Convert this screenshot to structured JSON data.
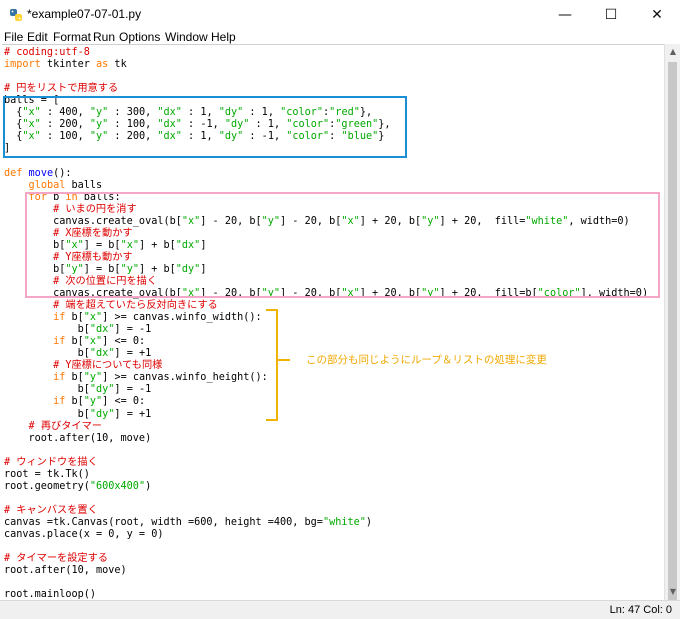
{
  "window": {
    "title": "*example07-07-01.py",
    "minimize_glyph": "—",
    "maximize_glyph": "☐",
    "close_glyph": "✕"
  },
  "menu": [
    "File",
    "Edit",
    "Format",
    "Run",
    "Options",
    "Window",
    "Help"
  ],
  "code": [
    [
      [
        "com",
        "# coding:utf-8"
      ]
    ],
    [
      [
        "kw",
        "import"
      ],
      [
        "",
        " tkinter "
      ],
      [
        "kw",
        "as"
      ],
      [
        "",
        " tk"
      ]
    ],
    [
      [
        "",
        ""
      ]
    ],
    [
      [
        "com",
        "# 円をリストで用意する"
      ]
    ],
    [
      [
        "",
        "balls = ["
      ]
    ],
    [
      [
        "",
        "  {"
      ],
      [
        "str",
        "\"x\""
      ],
      [
        "",
        " : 400, "
      ],
      [
        "str",
        "\"y\""
      ],
      [
        "",
        " : 300, "
      ],
      [
        "str",
        "\"dx\""
      ],
      [
        "",
        " : 1, "
      ],
      [
        "str",
        "\"dy\""
      ],
      [
        "",
        " : 1, "
      ],
      [
        "str",
        "\"color\""
      ],
      [
        "",
        ":"
      ],
      [
        "str",
        "\"red\""
      ],
      [
        "",
        "},"
      ]
    ],
    [
      [
        "",
        "  {"
      ],
      [
        "str",
        "\"x\""
      ],
      [
        "",
        " : 200, "
      ],
      [
        "str",
        "\"y\""
      ],
      [
        "",
        " : 100, "
      ],
      [
        "str",
        "\"dx\""
      ],
      [
        "",
        " : -1, "
      ],
      [
        "str",
        "\"dy\""
      ],
      [
        "",
        " : 1, "
      ],
      [
        "str",
        "\"color\""
      ],
      [
        "",
        ":"
      ],
      [
        "str",
        "\"green\""
      ],
      [
        "",
        "},"
      ]
    ],
    [
      [
        "",
        "  {"
      ],
      [
        "str",
        "\"x\""
      ],
      [
        "",
        " : 100, "
      ],
      [
        "str",
        "\"y\""
      ],
      [
        "",
        " : 200, "
      ],
      [
        "str",
        "\"dx\""
      ],
      [
        "",
        " : 1, "
      ],
      [
        "str",
        "\"dy\""
      ],
      [
        "",
        " : -1, "
      ],
      [
        "str",
        "\"color\""
      ],
      [
        "",
        ": "
      ],
      [
        "str",
        "\"blue\""
      ],
      [
        "",
        "}"
      ]
    ],
    [
      [
        "",
        "]"
      ]
    ],
    [
      [
        "",
        ""
      ]
    ],
    [
      [
        "kw",
        "def"
      ],
      [
        "",
        " "
      ],
      [
        "def",
        "move"
      ],
      [
        "",
        "():"
      ]
    ],
    [
      [
        "",
        "    "
      ],
      [
        "kw",
        "global"
      ],
      [
        "",
        " balls"
      ]
    ],
    [
      [
        "",
        "    "
      ],
      [
        "kw",
        "for"
      ],
      [
        "",
        " b "
      ],
      [
        "kw",
        "in"
      ],
      [
        "",
        " balls:"
      ]
    ],
    [
      [
        "",
        "        "
      ],
      [
        "com",
        "# いまの円を消す"
      ]
    ],
    [
      [
        "",
        "        canvas.create_oval(b["
      ],
      [
        "str",
        "\"x\""
      ],
      [
        "",
        "] - 20, b["
      ],
      [
        "str",
        "\"y\""
      ],
      [
        "",
        "] - 20, b["
      ],
      [
        "str",
        "\"x\""
      ],
      [
        "",
        "] + 20, b["
      ],
      [
        "str",
        "\"y\""
      ],
      [
        "",
        "] + 20,  fill="
      ],
      [
        "str",
        "\"white\""
      ],
      [
        "",
        ", width=0)"
      ]
    ],
    [
      [
        "",
        "        "
      ],
      [
        "com",
        "# X座標を動かす"
      ]
    ],
    [
      [
        "",
        "        b["
      ],
      [
        "str",
        "\"x\""
      ],
      [
        "",
        "] = b["
      ],
      [
        "str",
        "\"x\""
      ],
      [
        "",
        "] + b["
      ],
      [
        "str",
        "\"dx\""
      ],
      [
        "",
        "]"
      ]
    ],
    [
      [
        "",
        "        "
      ],
      [
        "com",
        "# Y座標も動かす"
      ]
    ],
    [
      [
        "",
        "        b["
      ],
      [
        "str",
        "\"y\""
      ],
      [
        "",
        "] = b["
      ],
      [
        "str",
        "\"y\""
      ],
      [
        "",
        "] + b["
      ],
      [
        "str",
        "\"dy\""
      ],
      [
        "",
        "]"
      ]
    ],
    [
      [
        "",
        "        "
      ],
      [
        "com",
        "# 次の位置に円を描く"
      ]
    ],
    [
      [
        "",
        "        canvas.create_oval(b["
      ],
      [
        "str",
        "\"x\""
      ],
      [
        "",
        "] - 20, b["
      ],
      [
        "str",
        "\"y\""
      ],
      [
        "",
        "] - 20, b["
      ],
      [
        "str",
        "\"x\""
      ],
      [
        "",
        "] + 20, b["
      ],
      [
        "str",
        "\"y\""
      ],
      [
        "",
        "] + 20,  fill=b["
      ],
      [
        "str",
        "\"color\""
      ],
      [
        "",
        "], width=0)"
      ]
    ],
    [
      [
        "",
        "        "
      ],
      [
        "com",
        "# 端を超えていたら反対向きにする"
      ]
    ],
    [
      [
        "",
        "        "
      ],
      [
        "kw",
        "if"
      ],
      [
        "",
        " b["
      ],
      [
        "str",
        "\"x\""
      ],
      [
        "",
        "] >= canvas.winfo_width():"
      ]
    ],
    [
      [
        "",
        "            b["
      ],
      [
        "str",
        "\"dx\""
      ],
      [
        "",
        "] = -1"
      ]
    ],
    [
      [
        "",
        "        "
      ],
      [
        "kw",
        "if"
      ],
      [
        "",
        " b["
      ],
      [
        "str",
        "\"x\""
      ],
      [
        "",
        "] <= 0:"
      ]
    ],
    [
      [
        "",
        "            b["
      ],
      [
        "str",
        "\"dx\""
      ],
      [
        "",
        "] = +1"
      ]
    ],
    [
      [
        "",
        "        "
      ],
      [
        "com",
        "# Y座標についても同様"
      ]
    ],
    [
      [
        "",
        "        "
      ],
      [
        "kw",
        "if"
      ],
      [
        "",
        " b["
      ],
      [
        "str",
        "\"y\""
      ],
      [
        "",
        "] >= canvas.winfo_height():"
      ]
    ],
    [
      [
        "",
        "            b["
      ],
      [
        "str",
        "\"dy\""
      ],
      [
        "",
        "] = -1"
      ]
    ],
    [
      [
        "",
        "        "
      ],
      [
        "kw",
        "if"
      ],
      [
        "",
        " b["
      ],
      [
        "str",
        "\"y\""
      ],
      [
        "",
        "] <= 0:"
      ]
    ],
    [
      [
        "",
        "            b["
      ],
      [
        "str",
        "\"dy\""
      ],
      [
        "",
        "] = +1"
      ]
    ],
    [
      [
        "",
        "    "
      ],
      [
        "com",
        "# 再びタイマー"
      ]
    ],
    [
      [
        "",
        "    root.after(10, move)"
      ]
    ],
    [
      [
        "",
        ""
      ]
    ],
    [
      [
        "com",
        "# ウィンドウを描く"
      ]
    ],
    [
      [
        "",
        "root = tk.Tk()"
      ]
    ],
    [
      [
        "",
        "root.geometry("
      ],
      [
        "str",
        "\"600x400\""
      ],
      [
        "",
        ")"
      ]
    ],
    [
      [
        "",
        ""
      ]
    ],
    [
      [
        "com",
        "# キャンバスを置く"
      ]
    ],
    [
      [
        "",
        "canvas =tk.Canvas(root, width =600, height =400, bg="
      ],
      [
        "str",
        "\"white\""
      ],
      [
        "",
        ")"
      ]
    ],
    [
      [
        "",
        "canvas.place(x = 0, y = 0)"
      ]
    ],
    [
      [
        "",
        ""
      ]
    ],
    [
      [
        "com",
        "# タイマーを設定する"
      ]
    ],
    [
      [
        "",
        "root.after(10, move)"
      ]
    ],
    [
      [
        "",
        ""
      ]
    ],
    [
      [
        "",
        "root.mainloop()"
      ]
    ],
    [
      [
        "",
        ""
      ]
    ]
  ],
  "annotation": {
    "note": "この部分も同じようにループ＆リストの処理に変更",
    "blue_box_color": "#1a8fd6",
    "pink_box_color": "#f4a6c6",
    "bracket_color": "#f0b400"
  },
  "status": {
    "position": "Ln: 47  Col: 0"
  }
}
